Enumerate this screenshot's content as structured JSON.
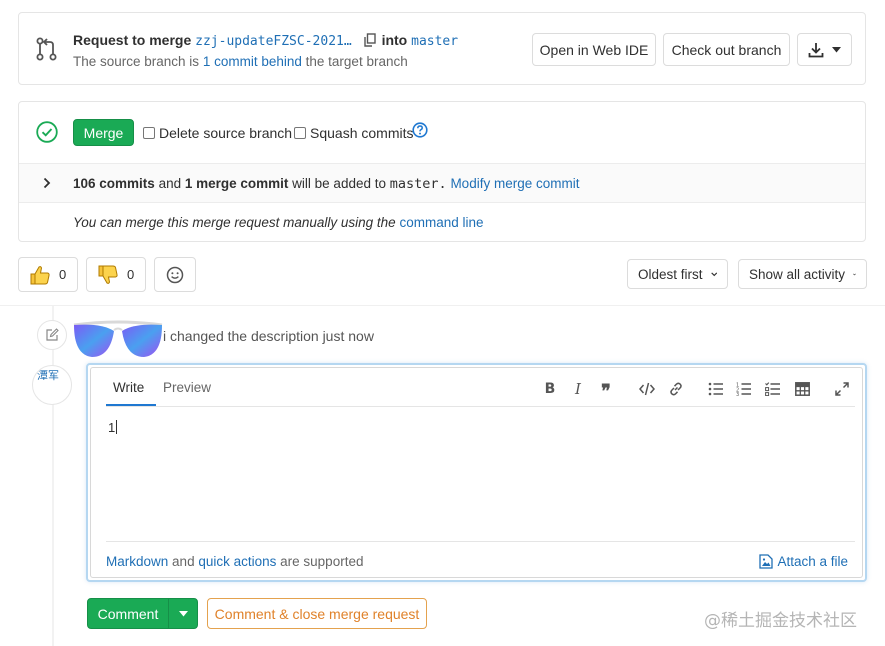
{
  "mr_header": {
    "request_prefix": "Request to merge",
    "source_branch": "zzj-updateFZSC-2021…",
    "into_label": "into",
    "target_branch": "master",
    "sub_prefix": "The source branch is",
    "sub_link": "1 commit behind",
    "sub_suffix": "the target branch",
    "open_webide": "Open in Web IDE",
    "checkout_branch": "Check out branch"
  },
  "merge_widget": {
    "merge_label": "Merge",
    "delete_source": "Delete source branch",
    "squash_commits": "Squash commits",
    "commits_count": "106 commits",
    "and_text": "and",
    "merge_commit_count": "1 merge commit",
    "will_be_added": "will be added to",
    "target": "master.",
    "modify_link": "Modify merge commit",
    "manual_text": "You can merge this merge request manually using the",
    "command_line_link": "command line"
  },
  "awards": {
    "thumbs_up_count": "0",
    "thumbs_down_count": "0"
  },
  "filters": {
    "sort_label": "Oldest first",
    "activity_label": "Show all activity"
  },
  "activity": {
    "user_fragment": "i",
    "action_text": "changed the description just now",
    "avatar_alt": "潭军"
  },
  "editor": {
    "tab_write": "Write",
    "tab_preview": "Preview",
    "content": "1",
    "markdown_link": "Markdown",
    "and_text": "and",
    "quick_actions_link": "quick actions",
    "supported_text": "are supported",
    "attach_label": "Attach a file"
  },
  "actions": {
    "comment_label": "Comment",
    "close_label": "Comment & close merge request"
  },
  "watermark": "@稀土掘金技术社区",
  "colors": {
    "green": "#1aaa55",
    "link": "#1f6fb5",
    "warning": "#e0822a"
  }
}
